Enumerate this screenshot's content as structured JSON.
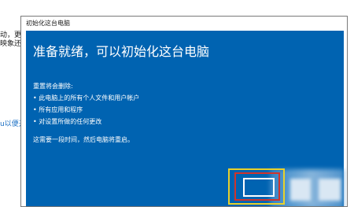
{
  "background": {
    "line1": "动，更",
    "line2": "映象还",
    "link": "u以便开"
  },
  "dialog": {
    "title": "初始化这台电脑",
    "heading": "准备就绪，可以初始化这台电脑",
    "subheading": "重置将会删除:",
    "bullets": [
      "• 此电脑上的所有个人文件和用户帐户",
      "• 所有应用和程序",
      "• 对设置所做的任何更改"
    ],
    "note": "这需要一段时间，然后电脑将重启。",
    "button_label": ""
  },
  "colors": {
    "dialog_blue": "#0063b1",
    "highlight_yellow": "#e8d12b",
    "highlight_red": "#d0342c"
  }
}
